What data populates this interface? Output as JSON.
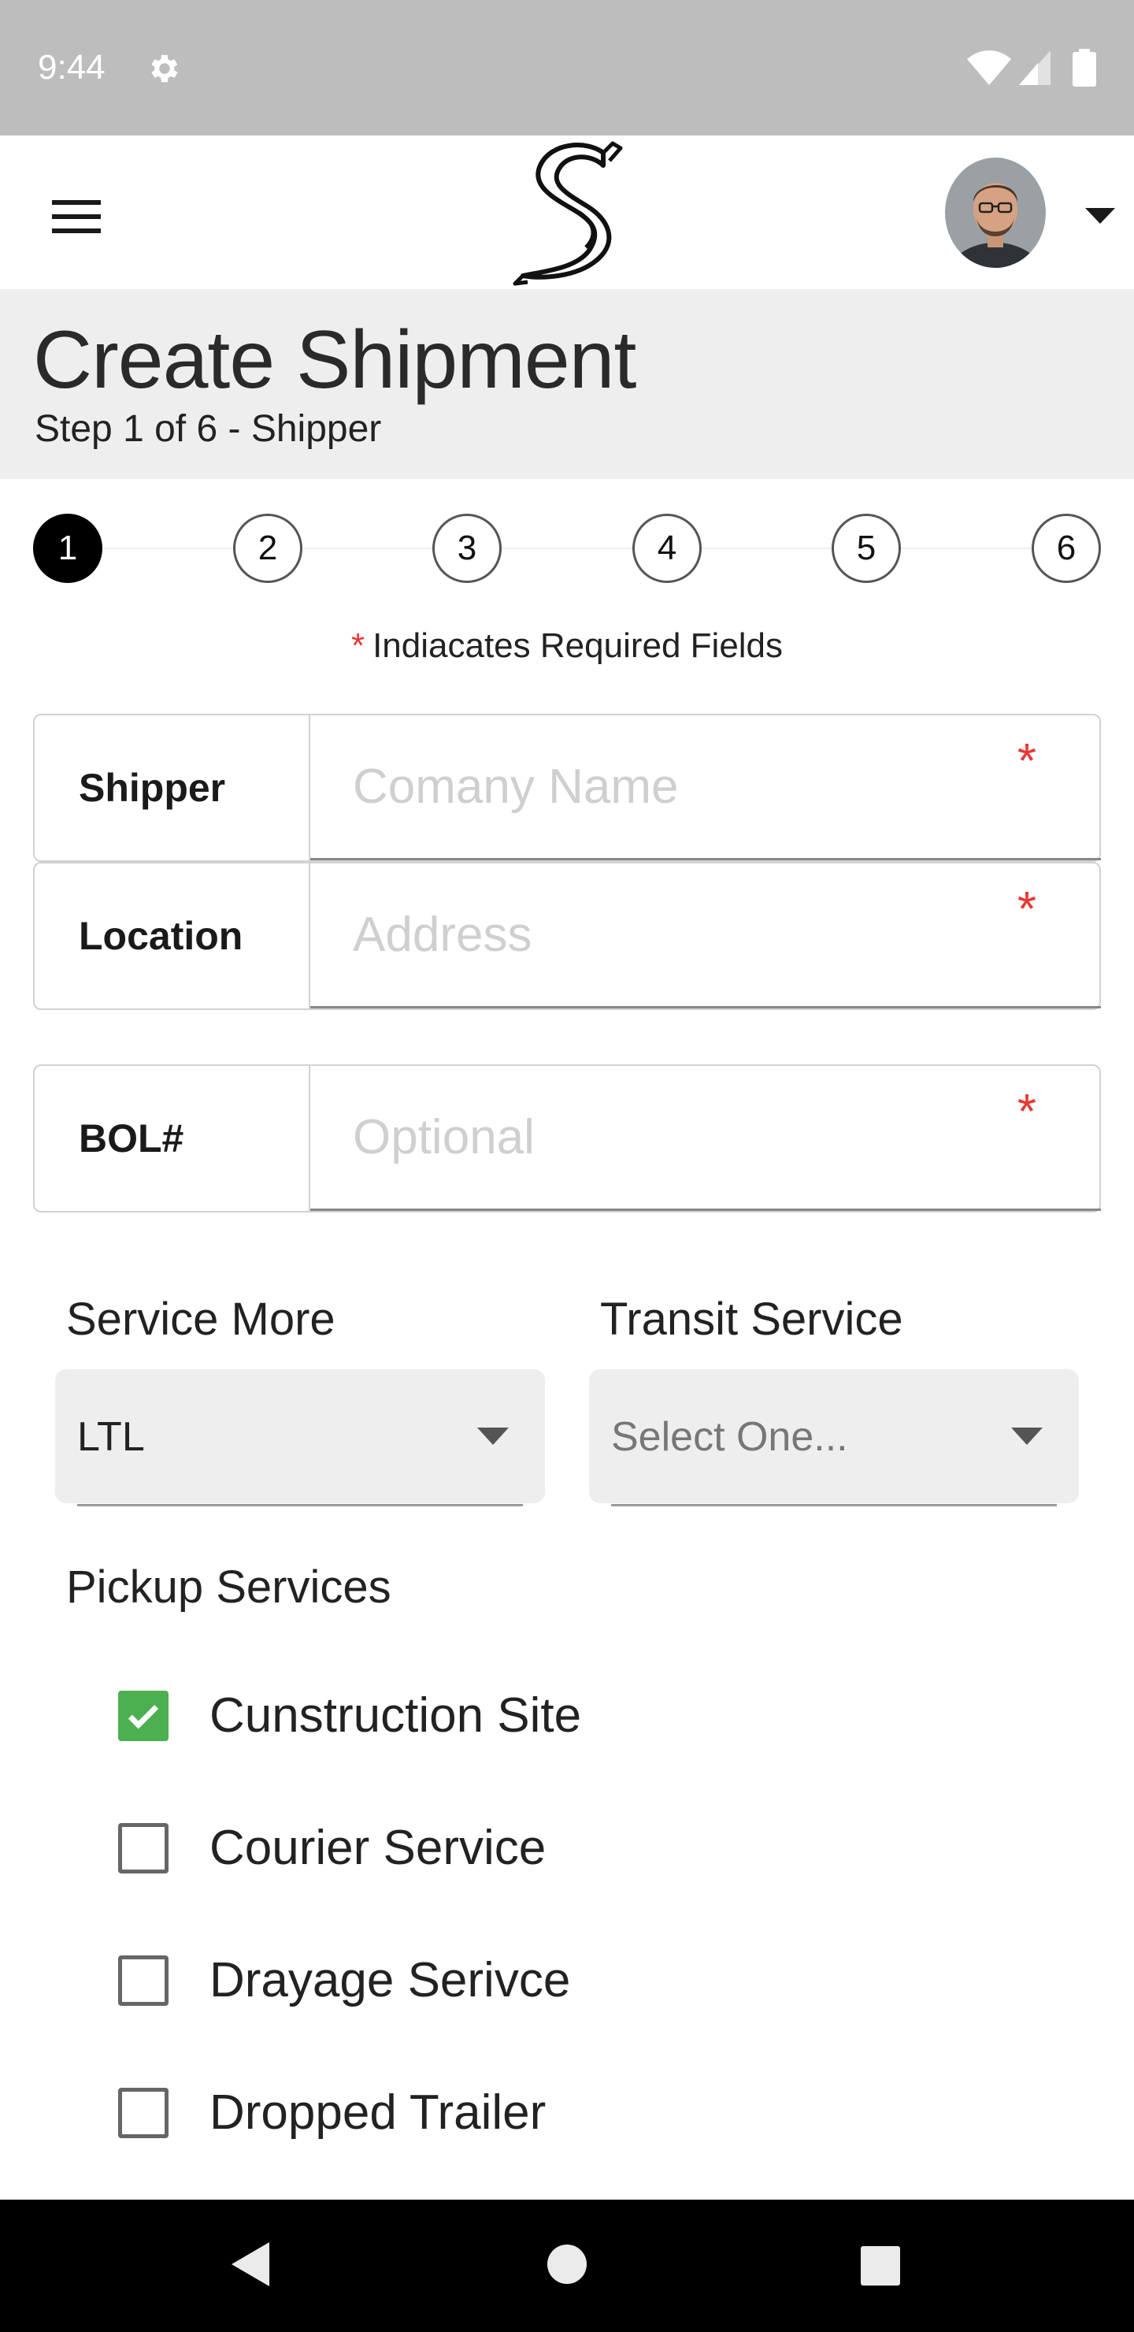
{
  "status_bar": {
    "time": "9:44"
  },
  "app_bar": {
    "menu_icon": "menu-icon",
    "logo": "script-s-logo",
    "avatar": "user-avatar"
  },
  "header": {
    "title": "Create Shipment",
    "subtitle": "Step 1 of 6 - Shipper"
  },
  "stepper": {
    "steps": [
      "1",
      "2",
      "3",
      "4",
      "5",
      "6"
    ],
    "active_step": 1
  },
  "required_note": {
    "star": "*",
    "text": "Indiacates Required Fields"
  },
  "fields": {
    "shipper": {
      "label": "Shipper",
      "placeholder": "Comany Name",
      "value": "",
      "required_mark": "*"
    },
    "location": {
      "label": "Location",
      "placeholder": "Address",
      "value": "",
      "required_mark": "*"
    },
    "bol": {
      "label": "BOL#",
      "placeholder": "Optional",
      "value": "",
      "required_mark": "*"
    }
  },
  "selects": {
    "service_mode": {
      "label": "Service More",
      "value": "LTL"
    },
    "transit_service": {
      "label": "Transit Service",
      "value": "Select One..."
    }
  },
  "pickup_services": {
    "title": "Pickup Services",
    "items": [
      {
        "label": "Cunstruction Site",
        "checked": true
      },
      {
        "label": "Courier Service",
        "checked": false
      },
      {
        "label": "Drayage Serivce",
        "checked": false
      },
      {
        "label": "Dropped Trailer",
        "checked": false
      }
    ]
  },
  "colors": {
    "status_bar": "#bdbdbd",
    "header_bg": "#eeeeee",
    "required_star": "#e53935",
    "checkbox_checked": "#4caf50",
    "nav_bar": "#000000"
  }
}
